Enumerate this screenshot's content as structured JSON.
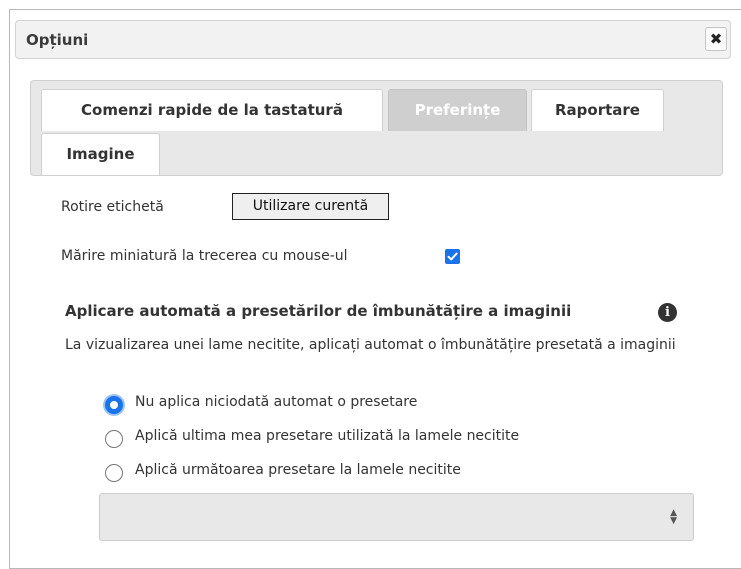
{
  "dialog": {
    "title": "Opțiuni",
    "close_icon": "✖"
  },
  "tabs": [
    {
      "label": "Comenzi rapide de la tastatură",
      "active": false
    },
    {
      "label": "Preferințe",
      "active": true
    },
    {
      "label": "Raportare",
      "active": false
    },
    {
      "label": "Imagine",
      "active": false
    }
  ],
  "preferences": {
    "label_rotation": {
      "label": "Rotire etichetă",
      "button_label": "Utilizare curentă"
    },
    "thumbnail_hover": {
      "label": "Mărire miniatură la trecerea cu mouse-ul",
      "checked": true
    },
    "auto_preset": {
      "heading": "Aplicare automată a presetărilor de îmbunătățire a imaginii",
      "info_icon": "info-icon",
      "description": "La vizualizarea unei lame necitite, aplicați automat o îmbunătățire presetată a imaginii",
      "options": [
        {
          "label": "Nu aplica niciodată automat o presetare",
          "selected": true
        },
        {
          "label": "Aplică ultima mea presetare utilizată la lamele necitite",
          "selected": false
        },
        {
          "label": "Aplică următoarea presetare la lamele necitite",
          "selected": false
        }
      ],
      "preset_select_value": ""
    }
  },
  "colors": {
    "accent": "#1a73e8",
    "active_tab_bg": "#cfcfcf",
    "tabs_bg": "#e8e8e8"
  }
}
